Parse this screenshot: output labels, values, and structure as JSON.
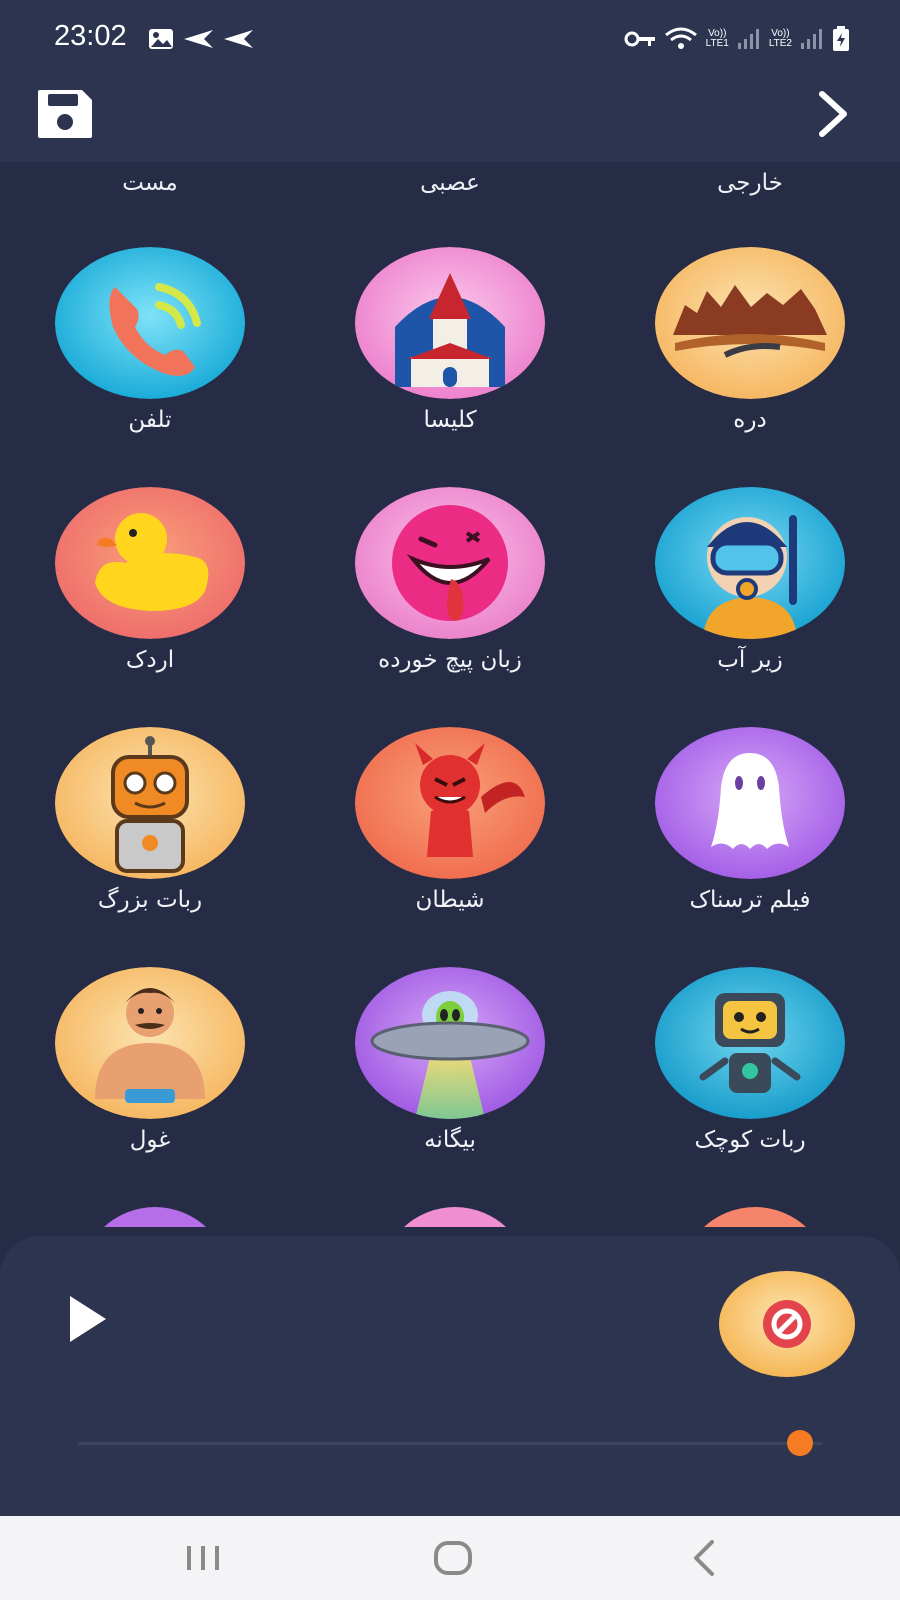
{
  "status": {
    "time": "23:02",
    "sim1": "LTE1",
    "sim2": "LTE2",
    "volte": "Vo))"
  },
  "top_labels": [
    "خارجی",
    "عصبی",
    "مست"
  ],
  "effects": [
    {
      "label": "دره",
      "icon": "canyon-icon",
      "bg": "#f9c97a"
    },
    {
      "label": "کلیسا",
      "icon": "church-icon",
      "bg": "#f39ad6"
    },
    {
      "label": "تلفن",
      "icon": "phone-icon",
      "bg": "#2fc2e6"
    },
    {
      "label": "زیر آب",
      "icon": "diver-icon",
      "bg": "#2fb9e0"
    },
    {
      "label": "زبان پیچ خورده",
      "icon": "tongue-face-icon",
      "bg": "#f08ed2"
    },
    {
      "label": "اردک",
      "icon": "duck-icon",
      "bg": "#f5846a"
    },
    {
      "label": "فیلم ترسناک",
      "icon": "ghost-icon",
      "bg": "#b773ee"
    },
    {
      "label": "شیطان",
      "icon": "devil-icon",
      "bg": "#f57f55"
    },
    {
      "label": "ربات بزرگ",
      "icon": "big-robot-icon",
      "bg": "#f9c97a"
    },
    {
      "label": "ربات کوچک",
      "icon": "small-robot-icon",
      "bg": "#27b3d8"
    },
    {
      "label": "بیگانه",
      "icon": "alien-ufo-icon",
      "bg": "#b56ee8"
    },
    {
      "label": "غول",
      "icon": "giant-icon",
      "bg": "#f9c97a"
    }
  ],
  "player": {
    "progress": 0.97
  },
  "colors": {
    "background": "#262c45",
    "bar": "#2d3450",
    "accent": "#f57c22"
  }
}
